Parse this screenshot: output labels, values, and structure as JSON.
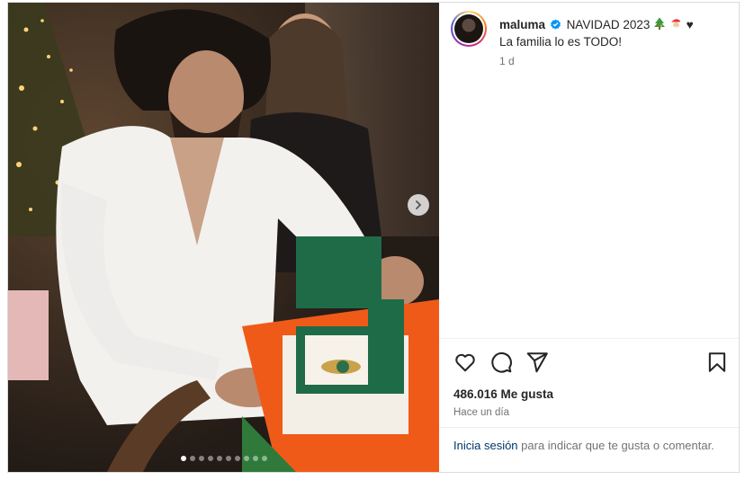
{
  "post": {
    "username": "maluma",
    "caption_title": "NAVIDAD 2023",
    "caption_line2": "La familia lo es TODO!",
    "time_short": "1 d",
    "likes": "486.016 Me gusta",
    "posted": "Hace un día",
    "login_link": "Inicia sesión",
    "login_rest": " para indicar que te gusta o comentar.",
    "heart_glyph": "♥"
  },
  "icons": {
    "verified": "verified-badge-icon",
    "tree": "christmas-tree-icon",
    "santa": "santa-icon",
    "like": "heart-outline-icon",
    "comment": "comment-icon",
    "share": "send-icon",
    "save": "bookmark-icon",
    "next": "chevron-right-icon"
  },
  "carousel": {
    "total": 10,
    "active": 1
  },
  "colors": {
    "verified": "#0095f6",
    "link": "#00376b",
    "muted": "#737373",
    "text": "#262626"
  }
}
